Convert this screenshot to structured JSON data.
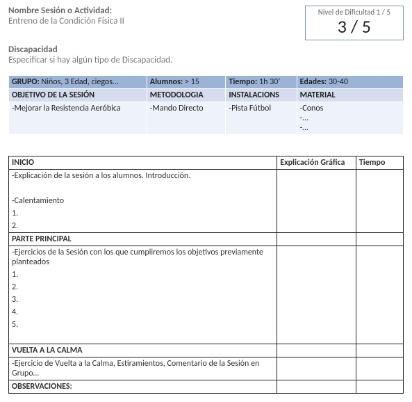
{
  "header": {
    "session_label": "Nombre Sesión o Actividad:",
    "session_value": "Entreno de la Condición Física II",
    "diff_label": "Nivel de Dificultad 1 / 5",
    "diff_value": "3 / 5",
    "disability_label": "Discapacidad",
    "disability_value": "Especificar si hay algún tipo de Discapacidad."
  },
  "info": {
    "grupo_label": "GRUPO:",
    "grupo_value": " Niños, 3 Edad, ciegos…",
    "alumnos_label": "Alumnos:",
    "alumnos_value": " > 15",
    "tiempo_label": "Tiempo:",
    "tiempo_value": " 1h 30’",
    "edades_label": "Edades:",
    "edades_value": " 30-40",
    "objetivo_label": "OBJETIVO DE LA SESIÓN",
    "metodologia_label": "METODOLOGIA",
    "instalaciones_label": "INSTALACIONS",
    "material_label": "MATERIAL",
    "objetivo_body": "-Mejorar la Resistencia Aeróbica",
    "metodologia_body": "-Mando Directo",
    "instalaciones_body": "-Pista Fútbol",
    "material_body_1": "-Conos",
    "material_body_2": "-…",
    "material_body_3": "-…"
  },
  "plan": {
    "col_explic": "Explicación Gráfica",
    "col_tiempo": "Tiempo",
    "inicio_label": "INICIO",
    "inicio_line1": "-Explicación de la sesión a los alumnos. Introducción.",
    "inicio_blank": " ",
    "inicio_line2": "-Calentamiento",
    "inicio_n1": "1.",
    "inicio_n2": "2.",
    "principal_label": "PARTE PRINCIPAL",
    "principal_line1": "-Ejercicios de la Sesión con los que cumpliremos los objetivos  previamente planteados",
    "p_n1": "1.",
    "p_n2": "2.",
    "p_n3": "3.",
    "p_n4": "4.",
    "p_n5": "5.",
    "calma_label": "VUELTA A LA CALMA",
    "calma_line1": " -Ejercicio de Vuelta a la Calma, Estiramientos, Comentario de la Sesión en Grupo…",
    "obs_label": "OBSERVACIONES:"
  }
}
